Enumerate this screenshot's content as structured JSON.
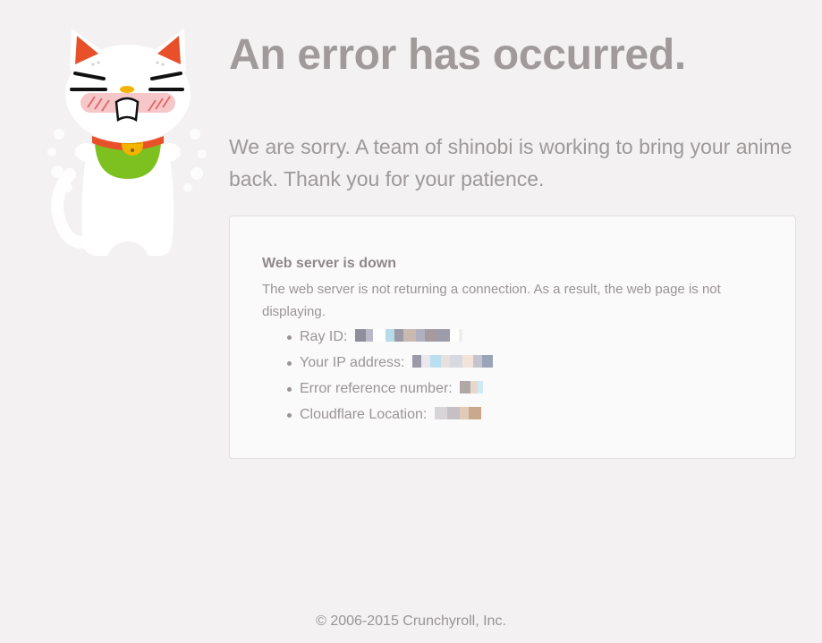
{
  "main": {
    "title": "An error has occurred.",
    "apology": "We are sorry. A team of shinobi is working to bring your anime back. Thank you for your patience."
  },
  "error_box": {
    "heading": "Web server is down",
    "description": "The web server is not returning a connection. As a result, the web page is not displaying.",
    "details": [
      {
        "label": "Ray ID:"
      },
      {
        "label": "Your IP address:"
      },
      {
        "label": "Error reference number:"
      },
      {
        "label": "Cloudflare Location:"
      }
    ]
  },
  "footer": {
    "copyright": "© 2006-2015 Crunchyroll, Inc."
  },
  "colors": {
    "background": "#f3f1f2",
    "text": "#9e9899",
    "box_background": "#fafafa",
    "mascot_ears": "#e8502a",
    "mascot_bib": "#7cc11f",
    "mascot_bell": "#f2b400"
  }
}
